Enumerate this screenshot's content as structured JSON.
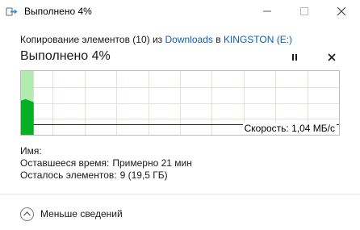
{
  "window": {
    "title": "Выполнено 4%",
    "icon": "copy-arrow-icon",
    "controls": [
      "minimize-icon",
      "maximize-icon",
      "close-icon"
    ]
  },
  "copy_info": {
    "prefix": "Копирование элементов (10) из ",
    "source": "Downloads",
    "middle": " в ",
    "destination": "KINGSTON (E:)"
  },
  "progress": {
    "heading": "Выполнено 4%",
    "percent": 4,
    "pause_icon": "pause-icon",
    "cancel_icon": "close-icon"
  },
  "speed_graph": {
    "speed_label": "Скорость: 1,04 МБ/с",
    "progress_fraction": 0.04,
    "fill_color": "#06b025",
    "shade_color": "#b3eab0",
    "grid_color": "#dbe8d7"
  },
  "details": {
    "name_label": "Имя:",
    "name_value": "",
    "time_label": "Оставшееся время:",
    "time_value": "Примерно 21 мин",
    "items_label": "Осталось элементов:",
    "items_value": "9 (19,5 ГБ)"
  },
  "footer": {
    "toggle_label": "Меньше сведений",
    "toggle_icon": "chevron-up-icon"
  },
  "colors": {
    "link": "#0a5fb4",
    "text": "#1a1a1a"
  }
}
